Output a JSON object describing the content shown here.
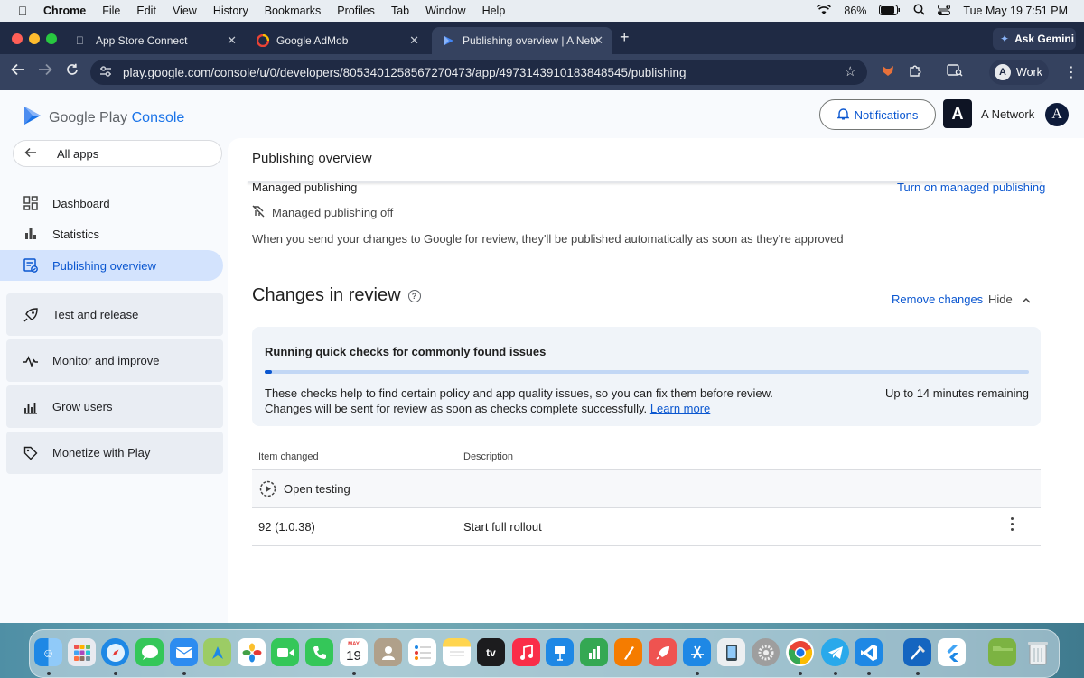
{
  "menubar": {
    "app": "Chrome",
    "items": [
      "File",
      "Edit",
      "View",
      "History",
      "Bookmarks",
      "Profiles",
      "Tab",
      "Window",
      "Help"
    ],
    "battery": "86%",
    "datetime": "Tue May 19  7:51 PM"
  },
  "tabs": [
    {
      "title": "App Store Connect",
      "icon": "apple-icon"
    },
    {
      "title": "Google AdMob",
      "icon": "admob-icon"
    },
    {
      "title": "Publishing overview | A Netwo",
      "icon": "play-console-icon",
      "active": true
    }
  ],
  "gemini_label": "Ask Gemini",
  "address_bar": {
    "url": "play.google.com/console/u/0/developers/8053401258567270473/app/4973143910183848545/publishing"
  },
  "profile": {
    "initial": "A",
    "label": "Work"
  },
  "header": {
    "logo_prefix": "Google Play",
    "logo_suffix": "Console",
    "notifications_label": "Notifications",
    "developer_badge": "A",
    "developer_name": "A Network",
    "avatar_initial": "A"
  },
  "sidebar": {
    "back_label": "All apps",
    "items": [
      {
        "label": "Dashboard",
        "icon": "dashboard-icon"
      },
      {
        "label": "Statistics",
        "icon": "bar-chart-icon"
      },
      {
        "label": "Publishing overview",
        "icon": "publishing-icon",
        "active": true
      }
    ],
    "groups": [
      {
        "label": "Test and release",
        "icon": "rocket-icon"
      },
      {
        "label": "Monitor and improve",
        "icon": "pulse-icon"
      },
      {
        "label": "Grow users",
        "icon": "grow-icon"
      },
      {
        "label": "Monetize with Play",
        "icon": "tag-icon"
      }
    ]
  },
  "main": {
    "page_title": "Publishing overview",
    "managed_publishing": {
      "label": "Managed publishing",
      "action": "Turn on managed publishing",
      "status": "Managed publishing off",
      "description": "When you send your changes to Google for review, they'll be published automatically as soon as they're approved"
    },
    "changes_in_review": {
      "title": "Changes in review",
      "remove_label": "Remove changes",
      "hide_label": "Hide",
      "checks": {
        "title": "Running quick checks for commonly found issues",
        "progress_percent": 1,
        "line1": "These checks help to find certain policy and app quality issues, so you can fix them before review.",
        "line2": "Changes will be sent for review as soon as checks complete successfully.",
        "learn_more": "Learn more",
        "remaining": "Up to 14 minutes remaining"
      },
      "table": {
        "headers": [
          "Item changed",
          "Description"
        ],
        "group": "Open testing",
        "rows": [
          {
            "item": "92 (1.0.38)",
            "description": "Start full rollout"
          }
        ]
      }
    }
  },
  "dock": {
    "calendar_month": "MAY",
    "calendar_day": "19",
    "tv_label": "tv",
    "apps": [
      "Finder",
      "Launchpad",
      "Safari",
      "Messages",
      "Mail",
      "Maps",
      "Photos",
      "FaceTime",
      "Phone",
      "Calendar",
      "Contacts",
      "Reminders",
      "Notes",
      "TV",
      "Music",
      "Keynote",
      "Numbers",
      "Pages",
      "RocketSim",
      "App Store",
      "Simulator",
      "System Settings",
      "Chrome",
      "Telegram",
      "VS Code",
      "Xcode",
      "Flutter",
      "Folder",
      "Trash"
    ]
  }
}
